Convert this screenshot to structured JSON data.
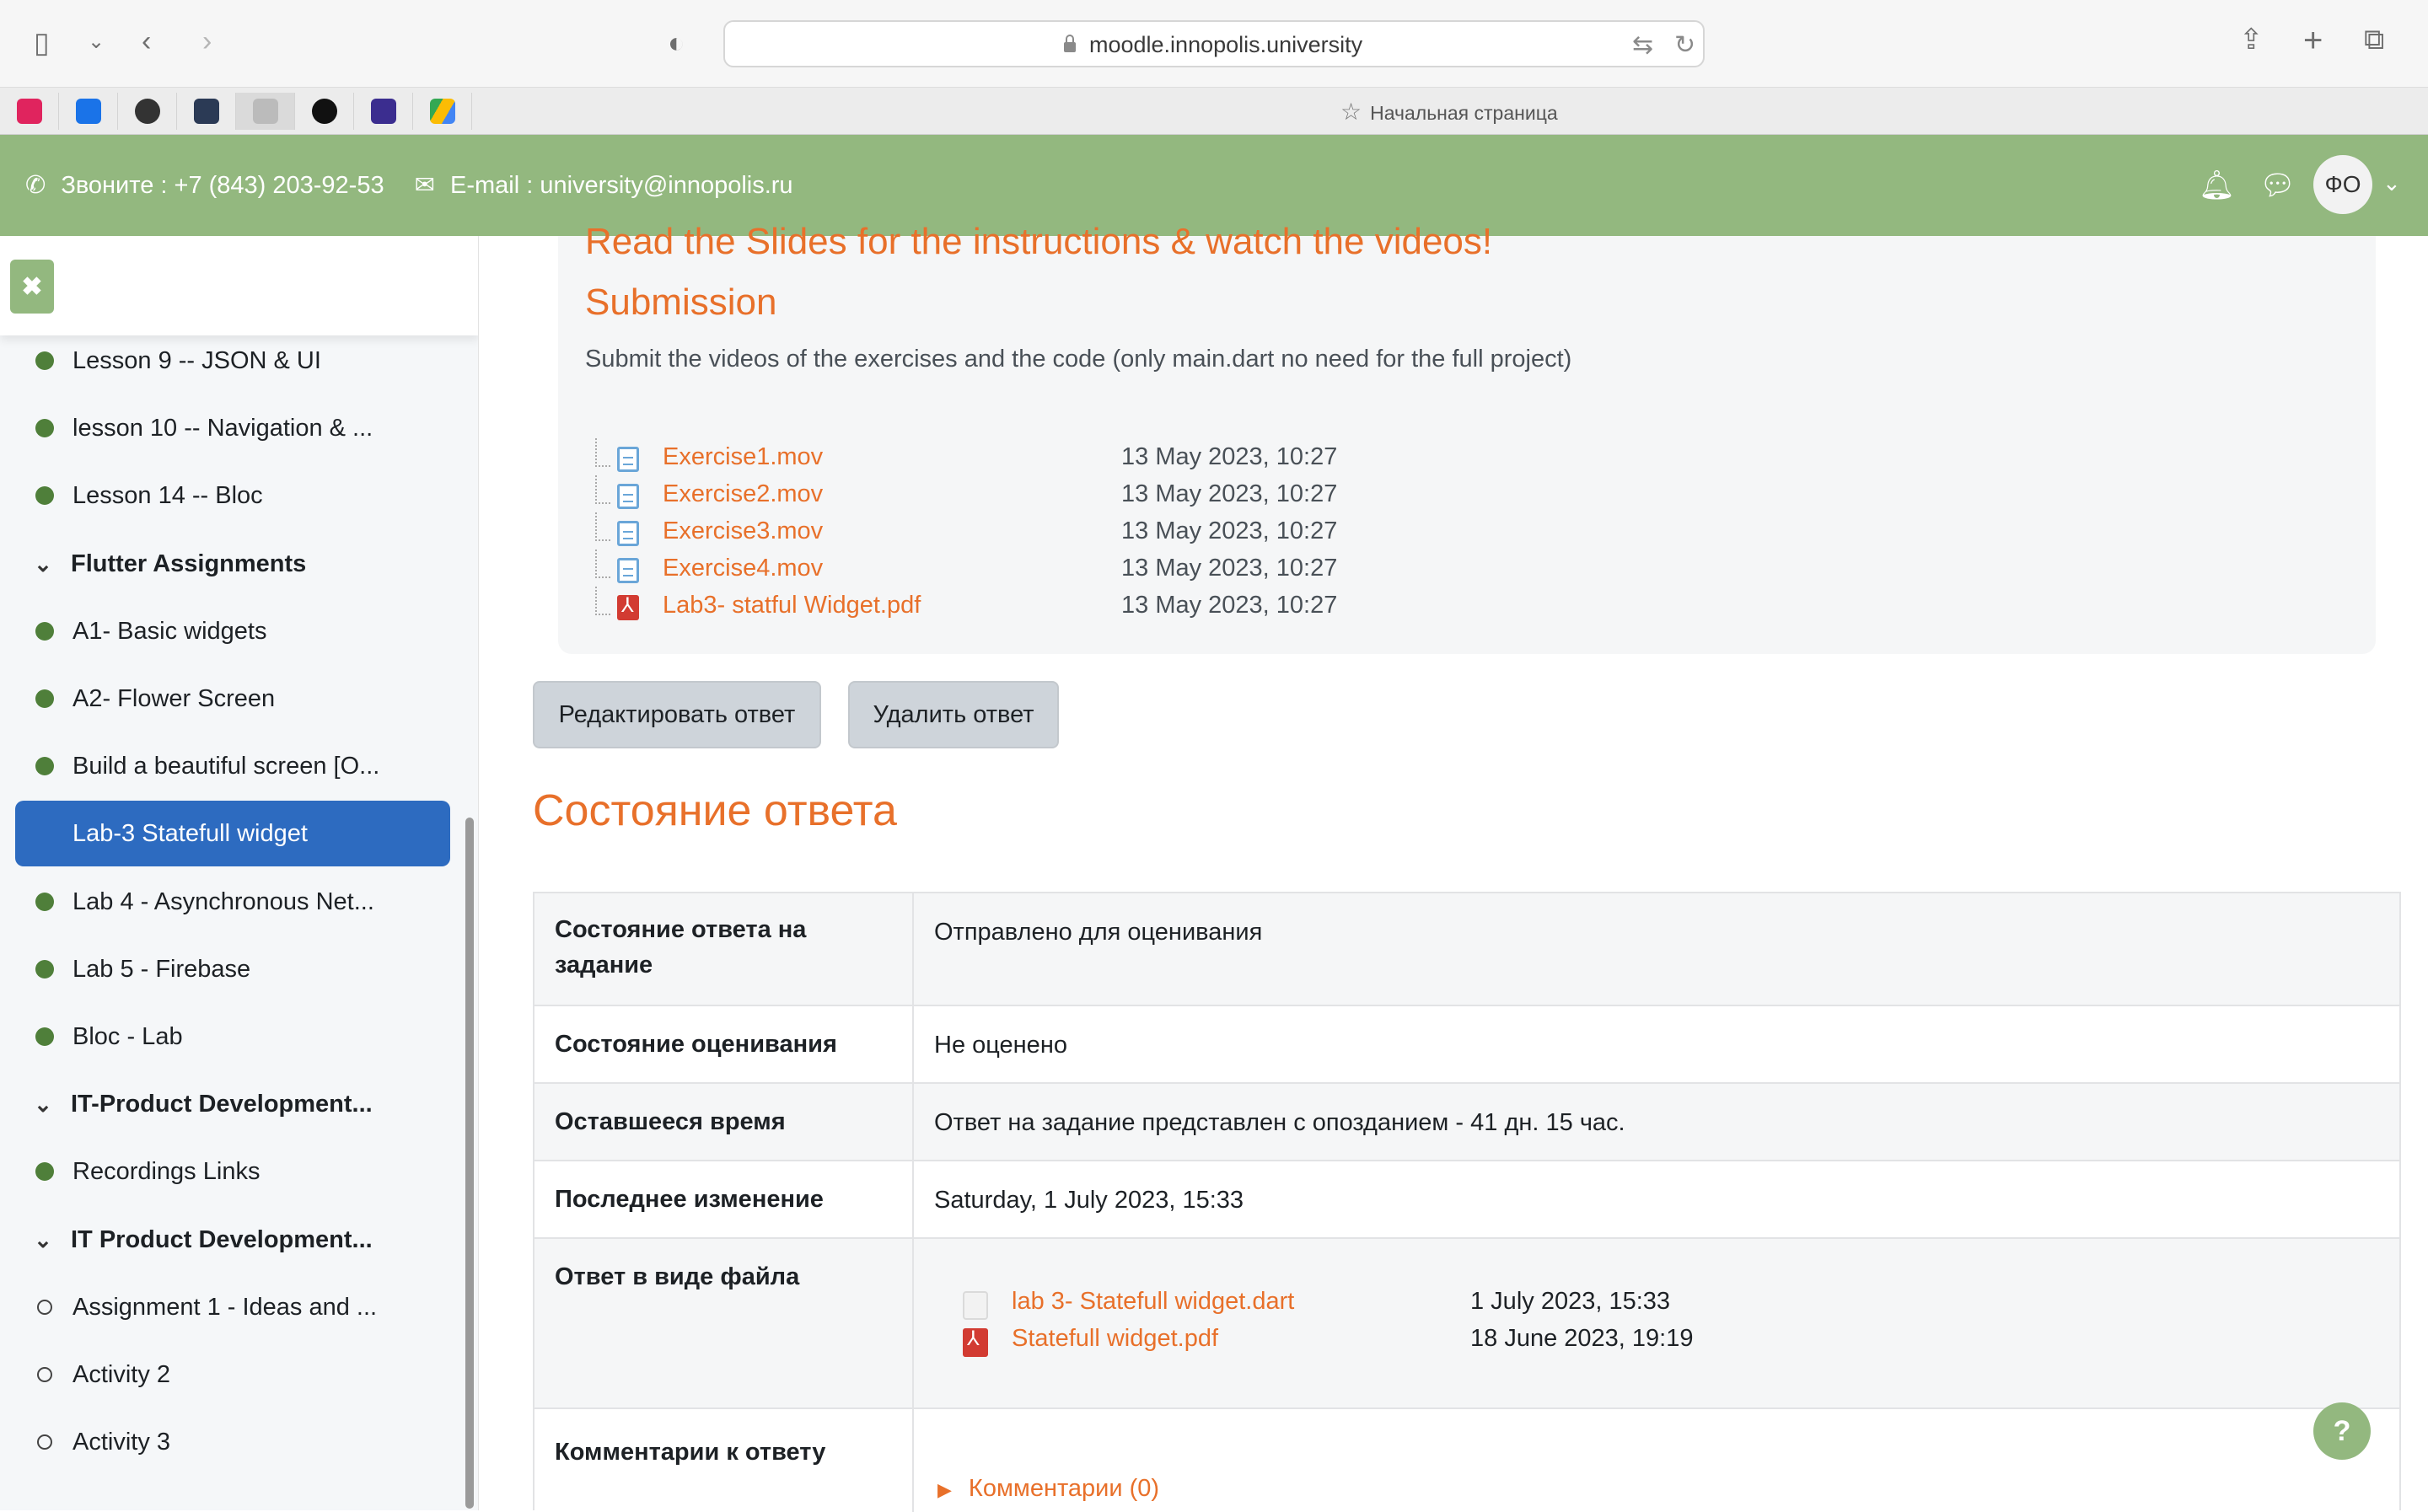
{
  "browser": {
    "url": "moodle.innopolis.university",
    "start_page": "Начальная страница"
  },
  "header": {
    "phone": "Звоните : +7 (843) 203-92-53",
    "email": "E-mail : university@innopolis.ru",
    "avatar_initials": "ФО"
  },
  "sidebar": {
    "items": [
      {
        "label": "Lesson 9 -- JSON & UI",
        "kind": "dot"
      },
      {
        "label": "lesson 10 -- Navigation & ...",
        "kind": "dot"
      },
      {
        "label": "Lesson 14 -- Bloc",
        "kind": "dot"
      },
      {
        "label": "Flutter Assignments",
        "kind": "section"
      },
      {
        "label": "A1- Basic widgets",
        "kind": "dot"
      },
      {
        "label": "A2- Flower Screen",
        "kind": "dot"
      },
      {
        "label": "Build a beautiful screen [O...",
        "kind": "dot"
      },
      {
        "label": "Lab-3 Statefull widget",
        "kind": "active"
      },
      {
        "label": "Lab 4 - Asynchronous Net...",
        "kind": "dot"
      },
      {
        "label": "Lab 5 - Firebase",
        "kind": "dot"
      },
      {
        "label": "Bloc - Lab",
        "kind": "dot"
      },
      {
        "label": "IT-Product Development...",
        "kind": "section"
      },
      {
        "label": "Recordings Links",
        "kind": "dot"
      },
      {
        "label": "IT Product Development...",
        "kind": "section"
      },
      {
        "label": "Assignment 1 - Ideas and ...",
        "kind": "empty"
      },
      {
        "label": "Activity 2",
        "kind": "empty"
      },
      {
        "label": "Activity 3",
        "kind": "empty"
      }
    ]
  },
  "instructions": {
    "heading_cut": "Read the Slides for the instructions & watch the videos!",
    "submission_heading": "Submission",
    "description": "Submit the videos of the exercises and the code (only main.dart no need for the full project)",
    "files": [
      {
        "name": "Exercise1.mov",
        "date": "13 May 2023, 10:27",
        "type": "mov"
      },
      {
        "name": "Exercise2.mov",
        "date": "13 May 2023, 10:27",
        "type": "mov"
      },
      {
        "name": "Exercise3.mov",
        "date": "13 May 2023, 10:27",
        "type": "mov"
      },
      {
        "name": "Exercise4.mov",
        "date": "13 May 2023, 10:27",
        "type": "mov"
      },
      {
        "name": "Lab3- statful Widget.pdf",
        "date": "13 May 2023, 10:27",
        "type": "pdf"
      }
    ]
  },
  "actions": {
    "edit": "Редактировать ответ",
    "delete": "Удалить ответ"
  },
  "status": {
    "heading": "Состояние ответа",
    "rows": [
      {
        "label": "Состояние ответа на задание",
        "value": "Отправлено для оценивания"
      },
      {
        "label": "Состояние оценивания",
        "value": "Не оценено"
      },
      {
        "label": "Оставшееся время",
        "value": "Ответ на задание представлен с опозданием - 41 дн. 15 час."
      },
      {
        "label": "Последнее изменение",
        "value": "Saturday, 1 July 2023, 15:33"
      },
      {
        "label": "Ответ в виде файла",
        "value": ""
      },
      {
        "label": "Комментарии к ответу",
        "value": ""
      }
    ],
    "submitted_files": [
      {
        "name": "lab 3- Statefull widget.dart",
        "date": "1 July 2023, 15:33",
        "type": "doc"
      },
      {
        "name": "Statefull widget.pdf",
        "date": "18 June 2023, 19:19",
        "type": "pdf"
      }
    ],
    "comments_link": "Комментарии (0)"
  },
  "help_label": "?"
}
